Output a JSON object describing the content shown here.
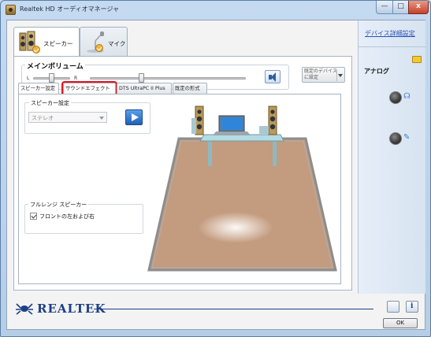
{
  "window": {
    "title": "Realtek HD オーディオマネージャ"
  },
  "window_buttons": {
    "minimize": "—",
    "maximize": "□",
    "close": "x"
  },
  "device_tabs": [
    {
      "label": "スピーカー",
      "selected": true
    },
    {
      "label": "マイク",
      "selected": false
    }
  ],
  "volume": {
    "title": "メインボリューム",
    "left_label": "L",
    "right_label": "R",
    "balance": 0.5,
    "level": 0.33
  },
  "default_device": {
    "label": "既定のデバイスに設定"
  },
  "subtabs": [
    {
      "label": "スピーカー設定",
      "selected": true
    },
    {
      "label": "サウンドエフェクト",
      "highlighted": true
    },
    {
      "label": "DTS UltraPC II Plus"
    },
    {
      "label": "既定の形式"
    }
  ],
  "speaker_config": {
    "title": "スピーカー設定",
    "selected": "ステレオ"
  },
  "fullrange": {
    "title": "フルレンジ スピーカー",
    "checkbox_label": "フロントの左および右",
    "checked": true
  },
  "side": {
    "link": "デバイス詳細設定",
    "analog_label": "アナログ"
  },
  "footer": {
    "brand": "REALTEK",
    "ok_label": "OK"
  },
  "colors": {
    "highlight": "#e3141c",
    "brand": "#1c3f86",
    "floor": "#c39b7e"
  }
}
